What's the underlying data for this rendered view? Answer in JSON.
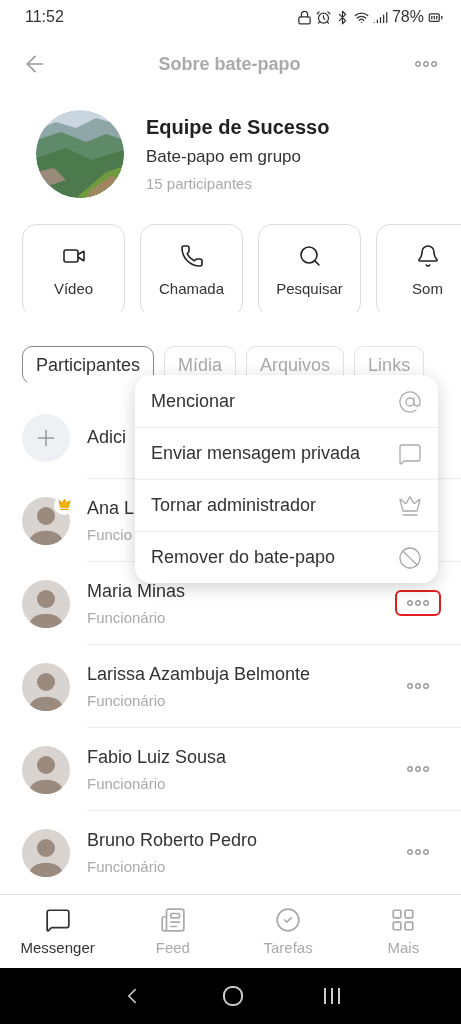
{
  "status_bar": {
    "time": "11:52",
    "battery": "78%"
  },
  "header": {
    "title": "Sobre bate-papo"
  },
  "group": {
    "name": "Equipe de Sucesso",
    "type": "Bate-papo em grupo",
    "participants": "15 participantes"
  },
  "actions": [
    {
      "kind": "video",
      "label": "Vídeo"
    },
    {
      "kind": "call",
      "label": "Chamada"
    },
    {
      "kind": "search",
      "label": "Pesquisar"
    },
    {
      "kind": "bell",
      "label": "Som"
    }
  ],
  "tabs": [
    {
      "label": "Participantes",
      "selected": true
    },
    {
      "label": "Mídia",
      "selected": false
    },
    {
      "label": "Arquivos",
      "selected": false
    },
    {
      "label": "Links",
      "selected": false
    }
  ],
  "add_row": {
    "label": "Adici"
  },
  "members": [
    {
      "name": "Ana L",
      "role": "Funcio",
      "admin": true,
      "more_button": false
    },
    {
      "name": "Maria Minas",
      "role": "Funcionário",
      "admin": false,
      "more_button": true,
      "highlighted": true
    },
    {
      "name": "Larissa Azambuja Belmonte",
      "role": "Funcionário",
      "admin": false,
      "more_button": true,
      "highlighted": false
    },
    {
      "name": "Fabio Luiz Sousa",
      "role": "Funcionário",
      "admin": false,
      "more_button": true,
      "highlighted": false
    },
    {
      "name": "Bruno Roberto Pedro",
      "role": "Funcionário",
      "admin": false,
      "more_button": true,
      "highlighted": false
    }
  ],
  "context_menu": [
    {
      "kind": "mention",
      "label": "Mencionar"
    },
    {
      "kind": "message",
      "label": "Enviar mensagem privada"
    },
    {
      "kind": "admin",
      "label": "Tornar administrador"
    },
    {
      "kind": "remove",
      "label": "Remover do bate-papo"
    }
  ],
  "bottom_nav": [
    {
      "kind": "messenger",
      "label": "Messenger",
      "selected": true
    },
    {
      "kind": "feed",
      "label": "Feed",
      "selected": false
    },
    {
      "kind": "tasks",
      "label": "Tarefas",
      "selected": false
    },
    {
      "kind": "more",
      "label": "Mais",
      "selected": false
    }
  ]
}
